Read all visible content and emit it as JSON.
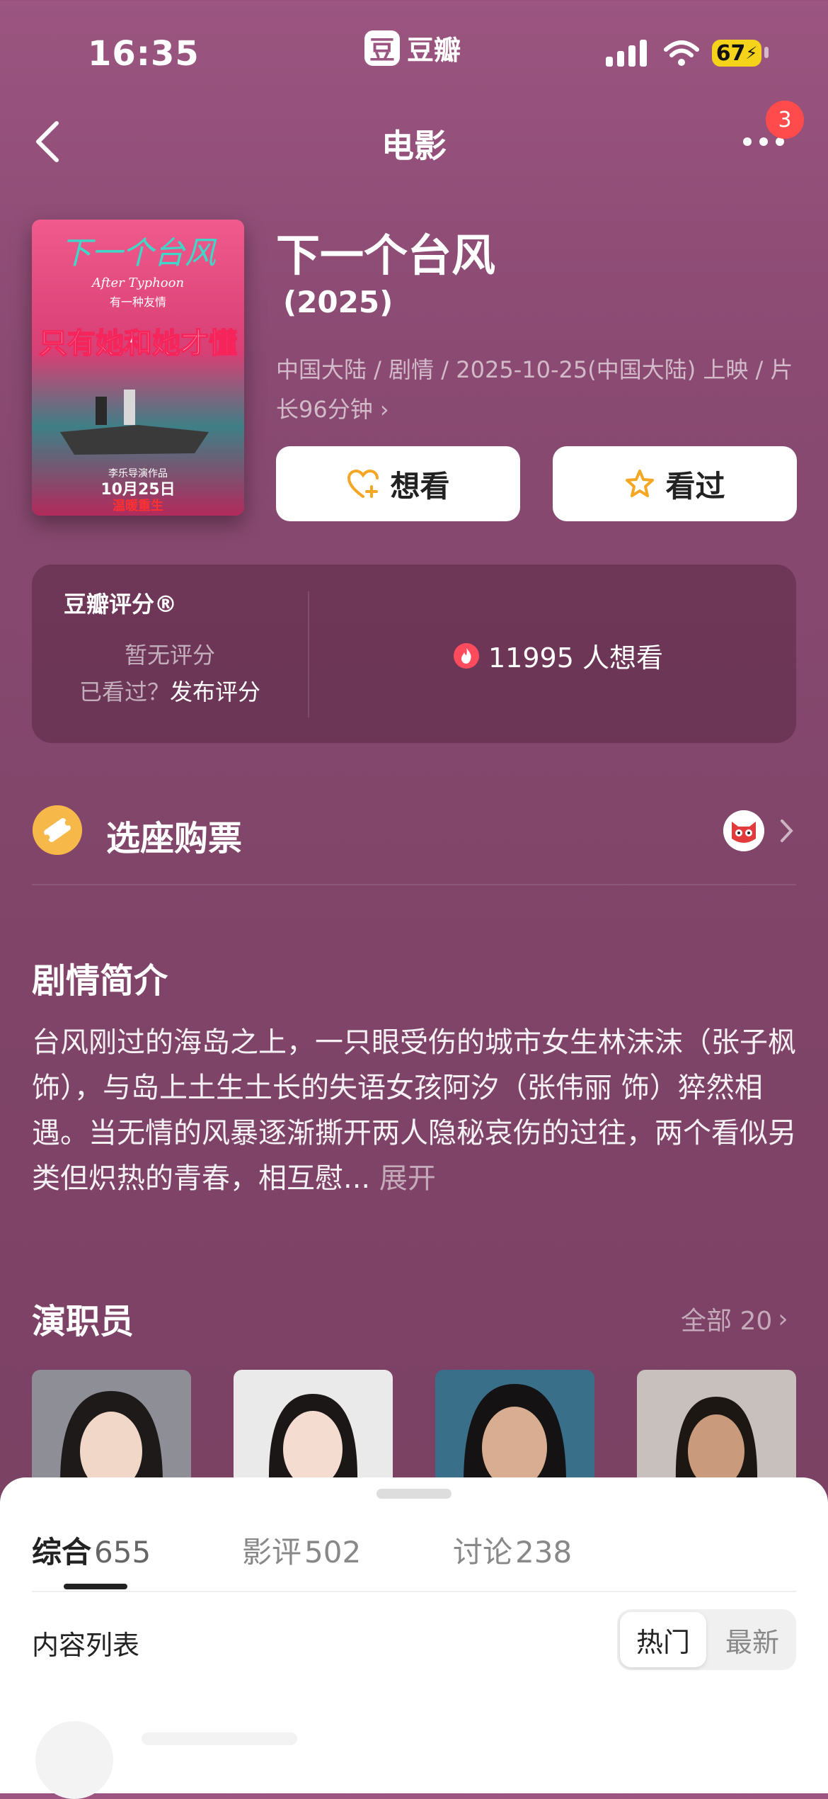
{
  "status_bar": {
    "time": "16:35",
    "app_logo": "豆",
    "app_name": "豆瓣",
    "battery": "67"
  },
  "nav": {
    "title": "电影",
    "notification_count": "3"
  },
  "movie": {
    "title": "下一个台风",
    "year": "(2025)",
    "meta_line1": "中国大陆 / 剧情 / 2025-10-25(中国大陆) 上映 / 片",
    "meta_line2": "长96分钟",
    "want_label": "想看",
    "watched_label": "看过"
  },
  "poster": {
    "title_art": "下一个台风",
    "subtitle_en": "After Typhoon",
    "tagline": "有一种友情",
    "big_slogan": "只有她和她才懂",
    "director_credit": "李乐导演作品",
    "release_date": "10月25日",
    "release_note": "温暖重生"
  },
  "rating": {
    "label": "豆瓣评分®",
    "no_rating": "暂无评分",
    "prompt_prefix": "已看过？",
    "prompt_link": "发布评分",
    "want_count": "11995 人想看"
  },
  "tickets": {
    "label": "选座购票"
  },
  "synopsis": {
    "title": "剧情简介",
    "text": "台风刚过的海岛之上，一只眼受伤的城市女生林沫沫（张子枫 饰），与岛上土生土长的失语女孩阿汐（张伟丽 饰）猝然相遇。当无情的风暴逐渐撕开两人隐秘哀伤的过往，两个看似另类但炽热的青春，相互慰... ",
    "expand": "展开"
  },
  "cast": {
    "title": "演职员",
    "all_label": "全部 20"
  },
  "bottom_sheet": {
    "tabs": [
      {
        "label": "综合",
        "count": "655"
      },
      {
        "label": "影评",
        "count": "502"
      },
      {
        "label": "讨论",
        "count": "238"
      }
    ],
    "list_title": "内容列表",
    "sort_hot": "热门",
    "sort_new": "最新"
  },
  "colors": {
    "accent_orange": "#f5a623",
    "background": "#8a4a72",
    "badge_red": "#ff4b4b",
    "battery_yellow": "#f5d31a"
  },
  "icons": [
    "back-icon",
    "more-icon",
    "heart-plus-icon",
    "star-icon",
    "flame-icon",
    "ticket-icon",
    "maoyan-cat-icon",
    "chevron-right-icon"
  ]
}
